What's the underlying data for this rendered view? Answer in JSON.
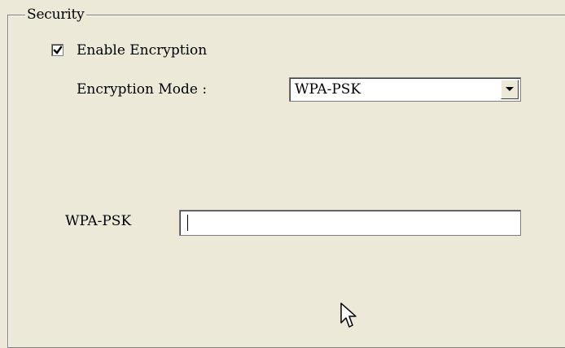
{
  "security": {
    "title": "Security",
    "enable_encryption": {
      "label": "Enable Encryption",
      "checked": true
    },
    "encryption_mode": {
      "label": "Encryption Mode :",
      "selected": "WPA-PSK"
    },
    "wpa_psk": {
      "label": "WPA-PSK",
      "value": ""
    }
  },
  "icons": {
    "checkbox": "checkmark-icon",
    "dropdown": "dropdown-arrow-icon",
    "cursor": "mouse-pointer-icon"
  }
}
